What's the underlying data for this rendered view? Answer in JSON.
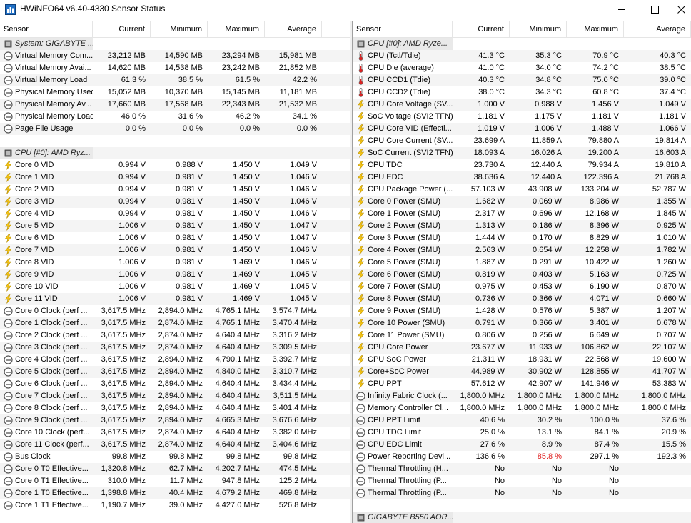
{
  "window": {
    "title": "HWiNFO64 v6.40-4330 Sensor Status"
  },
  "columns": {
    "sensor": "Sensor",
    "current": "Current",
    "minimum": "Minimum",
    "maximum": "Maximum",
    "average": "Average"
  },
  "left": {
    "rows": [
      {
        "type": "group",
        "name": "System: GIGABYTE ...",
        "icon": "chip-icon"
      },
      {
        "type": "row",
        "name": "Virtual Memory Com...",
        "icon": "gauge-icon",
        "cur": "23,212 MB",
        "min": "14,590 MB",
        "max": "23,294 MB",
        "avg": "15,981 MB"
      },
      {
        "type": "row",
        "name": "Virtual Memory Avai...",
        "icon": "gauge-icon",
        "cur": "14,620 MB",
        "min": "14,538 MB",
        "max": "23,242 MB",
        "avg": "21,852 MB"
      },
      {
        "type": "row",
        "name": "Virtual Memory Load",
        "icon": "gauge-icon",
        "cur": "61.3 %",
        "min": "38.5 %",
        "max": "61.5 %",
        "avg": "42.2 %"
      },
      {
        "type": "row",
        "name": "Physical Memory Used",
        "icon": "gauge-icon",
        "cur": "15,052 MB",
        "min": "10,370 MB",
        "max": "15,145 MB",
        "avg": "11,181 MB"
      },
      {
        "type": "row",
        "name": "Physical Memory Av...",
        "icon": "gauge-icon",
        "cur": "17,660 MB",
        "min": "17,568 MB",
        "max": "22,343 MB",
        "avg": "21,532 MB"
      },
      {
        "type": "row",
        "name": "Physical Memory Load",
        "icon": "gauge-icon",
        "cur": "46.0 %",
        "min": "31.6 %",
        "max": "46.2 %",
        "avg": "34.1 %"
      },
      {
        "type": "row",
        "name": "Page File Usage",
        "icon": "gauge-icon",
        "cur": "0.0 %",
        "min": "0.0 %",
        "max": "0.0 %",
        "avg": "0.0 %"
      },
      {
        "type": "spacer"
      },
      {
        "type": "group",
        "name": "CPU [#0]: AMD Ryz...",
        "icon": "chip-icon"
      },
      {
        "type": "row",
        "name": "Core 0 VID",
        "icon": "bolt-icon",
        "cur": "0.994 V",
        "min": "0.988 V",
        "max": "1.450 V",
        "avg": "1.049 V"
      },
      {
        "type": "row",
        "name": "Core 1 VID",
        "icon": "bolt-icon",
        "cur": "0.994 V",
        "min": "0.981 V",
        "max": "1.450 V",
        "avg": "1.046 V"
      },
      {
        "type": "row",
        "name": "Core 2 VID",
        "icon": "bolt-icon",
        "cur": "0.994 V",
        "min": "0.981 V",
        "max": "1.450 V",
        "avg": "1.046 V"
      },
      {
        "type": "row",
        "name": "Core 3 VID",
        "icon": "bolt-icon",
        "cur": "0.994 V",
        "min": "0.981 V",
        "max": "1.450 V",
        "avg": "1.046 V"
      },
      {
        "type": "row",
        "name": "Core 4 VID",
        "icon": "bolt-icon",
        "cur": "0.994 V",
        "min": "0.981 V",
        "max": "1.450 V",
        "avg": "1.046 V"
      },
      {
        "type": "row",
        "name": "Core 5 VID",
        "icon": "bolt-icon",
        "cur": "1.006 V",
        "min": "0.981 V",
        "max": "1.450 V",
        "avg": "1.047 V"
      },
      {
        "type": "row",
        "name": "Core 6 VID",
        "icon": "bolt-icon",
        "cur": "1.006 V",
        "min": "0.981 V",
        "max": "1.450 V",
        "avg": "1.047 V"
      },
      {
        "type": "row",
        "name": "Core 7 VID",
        "icon": "bolt-icon",
        "cur": "1.006 V",
        "min": "0.981 V",
        "max": "1.450 V",
        "avg": "1.046 V"
      },
      {
        "type": "row",
        "name": "Core 8 VID",
        "icon": "bolt-icon",
        "cur": "1.006 V",
        "min": "0.981 V",
        "max": "1.469 V",
        "avg": "1.046 V"
      },
      {
        "type": "row",
        "name": "Core 9 VID",
        "icon": "bolt-icon",
        "cur": "1.006 V",
        "min": "0.981 V",
        "max": "1.469 V",
        "avg": "1.045 V"
      },
      {
        "type": "row",
        "name": "Core 10 VID",
        "icon": "bolt-icon",
        "cur": "1.006 V",
        "min": "0.981 V",
        "max": "1.469 V",
        "avg": "1.045 V"
      },
      {
        "type": "row",
        "name": "Core 11 VID",
        "icon": "bolt-icon",
        "cur": "1.006 V",
        "min": "0.981 V",
        "max": "1.469 V",
        "avg": "1.045 V"
      },
      {
        "type": "row",
        "name": "Core 0 Clock (perf ...",
        "icon": "gauge-icon",
        "cur": "3,617.5 MHz",
        "min": "2,894.0 MHz",
        "max": "4,765.1 MHz",
        "avg": "3,574.7 MHz"
      },
      {
        "type": "row",
        "name": "Core 1 Clock (perf ...",
        "icon": "gauge-icon",
        "cur": "3,617.5 MHz",
        "min": "2,874.0 MHz",
        "max": "4,765.1 MHz",
        "avg": "3,470.4 MHz"
      },
      {
        "type": "row",
        "name": "Core 2 Clock (perf ...",
        "icon": "gauge-icon",
        "cur": "3,617.5 MHz",
        "min": "2,874.0 MHz",
        "max": "4,640.4 MHz",
        "avg": "3,316.2 MHz"
      },
      {
        "type": "row",
        "name": "Core 3 Clock (perf ...",
        "icon": "gauge-icon",
        "cur": "3,617.5 MHz",
        "min": "2,874.0 MHz",
        "max": "4,640.4 MHz",
        "avg": "3,309.5 MHz"
      },
      {
        "type": "row",
        "name": "Core 4 Clock (perf ...",
        "icon": "gauge-icon",
        "cur": "3,617.5 MHz",
        "min": "2,894.0 MHz",
        "max": "4,790.1 MHz",
        "avg": "3,392.7 MHz"
      },
      {
        "type": "row",
        "name": "Core 5 Clock (perf ...",
        "icon": "gauge-icon",
        "cur": "3,617.5 MHz",
        "min": "2,894.0 MHz",
        "max": "4,840.0 MHz",
        "avg": "3,310.7 MHz"
      },
      {
        "type": "row",
        "name": "Core 6 Clock (perf ...",
        "icon": "gauge-icon",
        "cur": "3,617.5 MHz",
        "min": "2,894.0 MHz",
        "max": "4,640.4 MHz",
        "avg": "3,434.4 MHz"
      },
      {
        "type": "row",
        "name": "Core 7 Clock (perf ...",
        "icon": "gauge-icon",
        "cur": "3,617.5 MHz",
        "min": "2,894.0 MHz",
        "max": "4,640.4 MHz",
        "avg": "3,511.5 MHz"
      },
      {
        "type": "row",
        "name": "Core 8 Clock (perf ...",
        "icon": "gauge-icon",
        "cur": "3,617.5 MHz",
        "min": "2,894.0 MHz",
        "max": "4,640.4 MHz",
        "avg": "3,401.4 MHz"
      },
      {
        "type": "row",
        "name": "Core 9 Clock (perf ...",
        "icon": "gauge-icon",
        "cur": "3,617.5 MHz",
        "min": "2,894.0 MHz",
        "max": "4,665.3 MHz",
        "avg": "3,676.6 MHz"
      },
      {
        "type": "row",
        "name": "Core 10 Clock (perf...",
        "icon": "gauge-icon",
        "cur": "3,617.5 MHz",
        "min": "2,874.0 MHz",
        "max": "4,640.4 MHz",
        "avg": "3,382.0 MHz"
      },
      {
        "type": "row",
        "name": "Core 11 Clock (perf...",
        "icon": "gauge-icon",
        "cur": "3,617.5 MHz",
        "min": "2,874.0 MHz",
        "max": "4,640.4 MHz",
        "avg": "3,404.6 MHz"
      },
      {
        "type": "row",
        "name": "Bus Clock",
        "icon": "gauge-icon",
        "cur": "99.8 MHz",
        "min": "99.8 MHz",
        "max": "99.8 MHz",
        "avg": "99.8 MHz"
      },
      {
        "type": "row",
        "name": "Core 0 T0 Effective...",
        "icon": "gauge-icon",
        "cur": "1,320.8 MHz",
        "min": "62.7 MHz",
        "max": "4,202.7 MHz",
        "avg": "474.5 MHz"
      },
      {
        "type": "row",
        "name": "Core 0 T1 Effective...",
        "icon": "gauge-icon",
        "cur": "310.0 MHz",
        "min": "11.7 MHz",
        "max": "947.8 MHz",
        "avg": "125.2 MHz"
      },
      {
        "type": "row",
        "name": "Core 1 T0 Effective...",
        "icon": "gauge-icon",
        "cur": "1,398.8 MHz",
        "min": "40.4 MHz",
        "max": "4,679.2 MHz",
        "avg": "469.8 MHz"
      },
      {
        "type": "row",
        "name": "Core 1 T1 Effective...",
        "icon": "gauge-icon",
        "cur": "1,190.7 MHz",
        "min": "39.0 MHz",
        "max": "4,427.0 MHz",
        "avg": "526.8 MHz"
      }
    ]
  },
  "right": {
    "rows": [
      {
        "type": "group",
        "name": "CPU [#0]: AMD Ryze...",
        "icon": "chip-icon"
      },
      {
        "type": "row",
        "name": "CPU (Tctl/Tdie)",
        "icon": "thermometer-icon",
        "cur": "41.3 °C",
        "min": "35.3 °C",
        "max": "70.9 °C",
        "avg": "40.3 °C"
      },
      {
        "type": "row",
        "name": "CPU Die (average)",
        "icon": "thermometer-icon",
        "cur": "41.0 °C",
        "min": "34.0 °C",
        "max": "74.2 °C",
        "avg": "38.5 °C"
      },
      {
        "type": "row",
        "name": "CPU CCD1 (Tdie)",
        "icon": "thermometer-icon",
        "cur": "40.3 °C",
        "min": "34.8 °C",
        "max": "75.0 °C",
        "avg": "39.0 °C"
      },
      {
        "type": "row",
        "name": "CPU CCD2 (Tdie)",
        "icon": "thermometer-icon",
        "cur": "38.0 °C",
        "min": "34.3 °C",
        "max": "60.8 °C",
        "avg": "37.4 °C"
      },
      {
        "type": "row",
        "name": "CPU Core Voltage (SV...",
        "icon": "bolt-icon",
        "cur": "1.000 V",
        "min": "0.988 V",
        "max": "1.456 V",
        "avg": "1.049 V"
      },
      {
        "type": "row",
        "name": "SoC Voltage (SVI2 TFN)",
        "icon": "bolt-icon",
        "cur": "1.181 V",
        "min": "1.175 V",
        "max": "1.181 V",
        "avg": "1.181 V"
      },
      {
        "type": "row",
        "name": "CPU Core VID (Effecti...",
        "icon": "bolt-icon",
        "cur": "1.019 V",
        "min": "1.006 V",
        "max": "1.488 V",
        "avg": "1.066 V"
      },
      {
        "type": "row",
        "name": "CPU Core Current (SV...",
        "icon": "bolt-icon",
        "cur": "23.699 A",
        "min": "11.859 A",
        "max": "79.880 A",
        "avg": "19.814 A"
      },
      {
        "type": "row",
        "name": "SoC Current (SVI2 TFN)",
        "icon": "bolt-icon",
        "cur": "18.093 A",
        "min": "16.026 A",
        "max": "19.200 A",
        "avg": "16.603 A"
      },
      {
        "type": "row",
        "name": "CPU TDC",
        "icon": "bolt-icon",
        "cur": "23.730 A",
        "min": "12.440 A",
        "max": "79.934 A",
        "avg": "19.810 A"
      },
      {
        "type": "row",
        "name": "CPU EDC",
        "icon": "bolt-icon",
        "cur": "38.636 A",
        "min": "12.440 A",
        "max": "122.396 A",
        "avg": "21.768 A"
      },
      {
        "type": "row",
        "name": "CPU Package Power (...",
        "icon": "bolt-icon",
        "cur": "57.103 W",
        "min": "43.908 W",
        "max": "133.204 W",
        "avg": "52.787 W"
      },
      {
        "type": "row",
        "name": "Core 0 Power (SMU)",
        "icon": "bolt-icon",
        "cur": "1.682 W",
        "min": "0.069 W",
        "max": "8.986 W",
        "avg": "1.355 W"
      },
      {
        "type": "row",
        "name": "Core 1 Power (SMU)",
        "icon": "bolt-icon",
        "cur": "2.317 W",
        "min": "0.696 W",
        "max": "12.168 W",
        "avg": "1.845 W"
      },
      {
        "type": "row",
        "name": "Core 2 Power (SMU)",
        "icon": "bolt-icon",
        "cur": "1.313 W",
        "min": "0.186 W",
        "max": "8.396 W",
        "avg": "0.925 W"
      },
      {
        "type": "row",
        "name": "Core 3 Power (SMU)",
        "icon": "bolt-icon",
        "cur": "1.444 W",
        "min": "0.170 W",
        "max": "8.829 W",
        "avg": "1.010 W"
      },
      {
        "type": "row",
        "name": "Core 4 Power (SMU)",
        "icon": "bolt-icon",
        "cur": "2.563 W",
        "min": "0.654 W",
        "max": "12.258 W",
        "avg": "1.782 W"
      },
      {
        "type": "row",
        "name": "Core 5 Power (SMU)",
        "icon": "bolt-icon",
        "cur": "1.887 W",
        "min": "0.291 W",
        "max": "10.422 W",
        "avg": "1.260 W"
      },
      {
        "type": "row",
        "name": "Core 6 Power (SMU)",
        "icon": "bolt-icon",
        "cur": "0.819 W",
        "min": "0.403 W",
        "max": "5.163 W",
        "avg": "0.725 W"
      },
      {
        "type": "row",
        "name": "Core 7 Power (SMU)",
        "icon": "bolt-icon",
        "cur": "0.975 W",
        "min": "0.453 W",
        "max": "6.190 W",
        "avg": "0.870 W"
      },
      {
        "type": "row",
        "name": "Core 8 Power (SMU)",
        "icon": "bolt-icon",
        "cur": "0.736 W",
        "min": "0.366 W",
        "max": "4.071 W",
        "avg": "0.660 W"
      },
      {
        "type": "row",
        "name": "Core 9 Power (SMU)",
        "icon": "bolt-icon",
        "cur": "1.428 W",
        "min": "0.576 W",
        "max": "5.387 W",
        "avg": "1.207 W"
      },
      {
        "type": "row",
        "name": "Core 10 Power (SMU)",
        "icon": "bolt-icon",
        "cur": "0.791 W",
        "min": "0.366 W",
        "max": "3.401 W",
        "avg": "0.678 W"
      },
      {
        "type": "row",
        "name": "Core 11 Power (SMU)",
        "icon": "bolt-icon",
        "cur": "0.806 W",
        "min": "0.256 W",
        "max": "6.649 W",
        "avg": "0.707 W"
      },
      {
        "type": "row",
        "name": "CPU Core Power",
        "icon": "bolt-icon",
        "cur": "23.677 W",
        "min": "11.933 W",
        "max": "106.862 W",
        "avg": "22.107 W"
      },
      {
        "type": "row",
        "name": "CPU SoC Power",
        "icon": "bolt-icon",
        "cur": "21.311 W",
        "min": "18.931 W",
        "max": "22.568 W",
        "avg": "19.600 W"
      },
      {
        "type": "row",
        "name": "Core+SoC Power",
        "icon": "bolt-icon",
        "cur": "44.989 W",
        "min": "30.902 W",
        "max": "128.855 W",
        "avg": "41.707 W"
      },
      {
        "type": "row",
        "name": "CPU PPT",
        "icon": "bolt-icon",
        "cur": "57.612 W",
        "min": "42.907 W",
        "max": "141.946 W",
        "avg": "53.383 W"
      },
      {
        "type": "row",
        "name": "Infinity Fabric Clock (...",
        "icon": "gauge-icon",
        "cur": "1,800.0 MHz",
        "min": "1,800.0 MHz",
        "max": "1,800.0 MHz",
        "avg": "1,800.0 MHz"
      },
      {
        "type": "row",
        "name": "Memory Controller Cl...",
        "icon": "gauge-icon",
        "cur": "1,800.0 MHz",
        "min": "1,800.0 MHz",
        "max": "1,800.0 MHz",
        "avg": "1,800.0 MHz"
      },
      {
        "type": "row",
        "name": "CPU PPT Limit",
        "icon": "gauge-icon",
        "cur": "40.6 %",
        "min": "30.2 %",
        "max": "100.0 %",
        "avg": "37.6 %"
      },
      {
        "type": "row",
        "name": "CPU TDC Limit",
        "icon": "gauge-icon",
        "cur": "25.0 %",
        "min": "13.1 %",
        "max": "84.1 %",
        "avg": "20.9 %"
      },
      {
        "type": "row",
        "name": "CPU EDC Limit",
        "icon": "gauge-icon",
        "cur": "27.6 %",
        "min": "8.9 %",
        "max": "87.4 %",
        "avg": "15.5 %"
      },
      {
        "type": "row",
        "name": "Power Reporting Devi...",
        "icon": "gauge-icon",
        "cur": "136.6 %",
        "min": "85.8 %",
        "max": "297.1 %",
        "avg": "192.3 %",
        "min_color": "#e02020"
      },
      {
        "type": "row",
        "name": "Thermal Throttling (H...",
        "icon": "gauge-icon",
        "cur": "No",
        "min": "No",
        "max": "No",
        "avg": ""
      },
      {
        "type": "row",
        "name": "Thermal Throttling (P...",
        "icon": "gauge-icon",
        "cur": "No",
        "min": "No",
        "max": "No",
        "avg": ""
      },
      {
        "type": "row",
        "name": "Thermal Throttling (P...",
        "icon": "gauge-icon",
        "cur": "No",
        "min": "No",
        "max": "No",
        "avg": ""
      },
      {
        "type": "spacer"
      },
      {
        "type": "group",
        "name": "GIGABYTE B550 AOR...",
        "icon": "chip-icon"
      }
    ]
  }
}
